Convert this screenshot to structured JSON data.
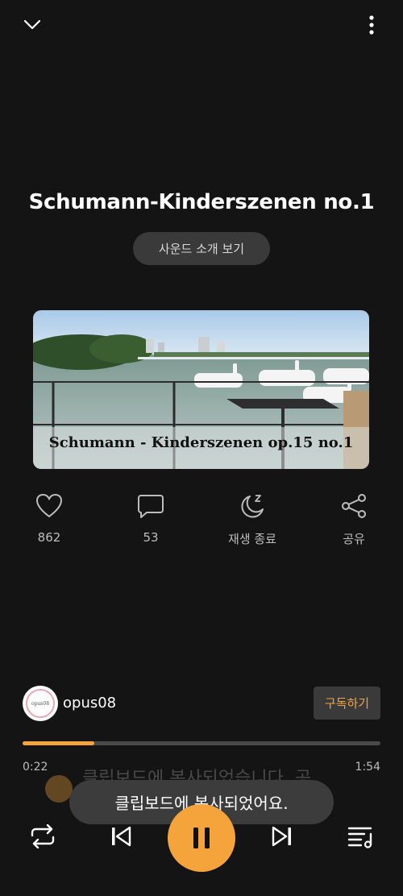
{
  "header": {
    "collapse_icon": "chevron-down-icon",
    "more_icon": "more-vertical-icon"
  },
  "track": {
    "title": "Schumann-Kinderszenen no.1",
    "intro_button": "사운드 소개 보기",
    "cover_caption": "Schumann - Kinderszenen op.15 no.1"
  },
  "actions": [
    {
      "icon": "heart-icon",
      "label": "862"
    },
    {
      "icon": "comment-icon",
      "label": "53"
    },
    {
      "icon": "sleep-timer-icon",
      "label": "재생 종료"
    },
    {
      "icon": "share-icon",
      "label": "공유"
    }
  ],
  "channel": {
    "name": "opus08",
    "avatar_text": "opus08",
    "subscribe_label": "구독하기"
  },
  "player": {
    "elapsed": "0:22",
    "duration": "1:54",
    "progress": 0.2
  },
  "background_row_text": "클립보드에 복사되었습니다. 공",
  "toast": {
    "message": "클립보드에 복사되었어요."
  },
  "controls": {
    "repeat_icon": "repeat-icon",
    "prev_icon": "skip-previous-icon",
    "pause_icon": "pause-icon",
    "next_icon": "skip-next-icon",
    "playlist_icon": "playlist-icon"
  },
  "colors": {
    "accent": "#f5a43c",
    "background": "#141414",
    "pill": "#3a3a3a"
  }
}
